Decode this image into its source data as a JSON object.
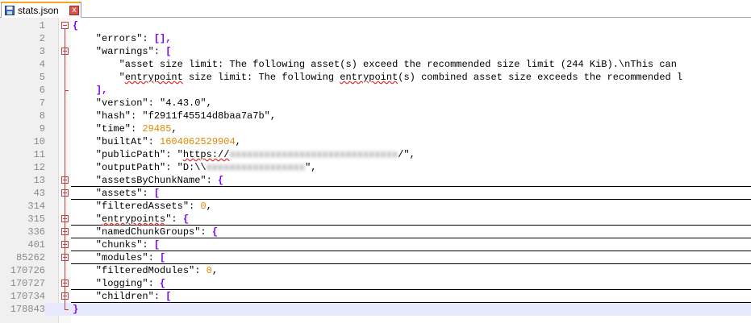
{
  "tab": {
    "filename": "stats.json",
    "close_symbol": "x"
  },
  "lines": [
    {
      "n": "1",
      "parts": [
        {
          "t": "{",
          "c": "p"
        }
      ]
    },
    {
      "n": "2",
      "parts": [
        {
          "t": "    \"errors\": ",
          "c": "s"
        },
        {
          "t": "[],",
          "c": "p"
        }
      ]
    },
    {
      "n": "3",
      "parts": [
        {
          "t": "    \"warnings\": ",
          "c": "s"
        },
        {
          "t": "[",
          "c": "p"
        }
      ]
    },
    {
      "n": "4",
      "parts": [
        {
          "t": "        \"asset size limit: The following asset(s) exceed the recommended size limit (244 KiB).\\nThis can",
          "c": "s"
        }
      ]
    },
    {
      "n": "5",
      "parts": [
        {
          "t": "        \"",
          "c": "s"
        },
        {
          "t": "entrypoint",
          "c": "s squiggle"
        },
        {
          "t": " size limit: The following ",
          "c": "s"
        },
        {
          "t": "entrypoint",
          "c": "s squiggle"
        },
        {
          "t": "(s) combined asset size exceeds the recommended l",
          "c": "s"
        }
      ]
    },
    {
      "n": "6",
      "parts": [
        {
          "t": "    ",
          "c": "s"
        },
        {
          "t": "],",
          "c": "p"
        }
      ]
    },
    {
      "n": "7",
      "parts": [
        {
          "t": "    \"version\": \"4.43.0\",",
          "c": "s"
        }
      ]
    },
    {
      "n": "8",
      "parts": [
        {
          "t": "    \"hash\": \"f2911f45514d8baa7a7b\",",
          "c": "s"
        }
      ]
    },
    {
      "n": "9",
      "parts": [
        {
          "t": "    \"time\": ",
          "c": "s"
        },
        {
          "t": "29485",
          "c": "n"
        },
        {
          "t": ",",
          "c": "s"
        }
      ]
    },
    {
      "n": "10",
      "parts": [
        {
          "t": "    \"builtAt\": ",
          "c": "s"
        },
        {
          "t": "1604062529904",
          "c": "n"
        },
        {
          "t": ",",
          "c": "s"
        }
      ]
    },
    {
      "n": "11",
      "parts": [
        {
          "t": "    \"publicPath\": \"",
          "c": "s"
        },
        {
          "t": "https://",
          "c": "s squiggle"
        },
        {
          "t": "xxxxxxxxxxxxxxxxxxxxxxxxxxxxx",
          "c": "blur"
        },
        {
          "t": "/\",",
          "c": "s"
        }
      ]
    },
    {
      "n": "12",
      "parts": [
        {
          "t": "    \"outputPath\": \"D:\\\\",
          "c": "s"
        },
        {
          "t": "xxxxxxxxxxxxxxxxx",
          "c": "blur"
        },
        {
          "t": "\",",
          "c": "s"
        }
      ]
    },
    {
      "n": "13",
      "parts": [
        {
          "t": "    \"assetsByChunkName\": ",
          "c": "s"
        },
        {
          "t": "{",
          "c": "p"
        }
      ]
    },
    {
      "n": "43",
      "parts": [
        {
          "t": "    \"assets\": ",
          "c": "s"
        },
        {
          "t": "[",
          "c": "p"
        }
      ]
    },
    {
      "n": "314",
      "parts": [
        {
          "t": "    \"filteredAssets\": ",
          "c": "s"
        },
        {
          "t": "0",
          "c": "n"
        },
        {
          "t": ",",
          "c": "s"
        }
      ]
    },
    {
      "n": "315",
      "parts": [
        {
          "t": "    \"",
          "c": "s"
        },
        {
          "t": "entrypoints",
          "c": "s squiggle"
        },
        {
          "t": "\": ",
          "c": "s"
        },
        {
          "t": "{",
          "c": "p"
        }
      ]
    },
    {
      "n": "336",
      "parts": [
        {
          "t": "    \"namedChunkGroups\": ",
          "c": "s"
        },
        {
          "t": "{",
          "c": "p"
        }
      ]
    },
    {
      "n": "401",
      "parts": [
        {
          "t": "    \"chunks\": ",
          "c": "s"
        },
        {
          "t": "[",
          "c": "p"
        }
      ]
    },
    {
      "n": "85262",
      "parts": [
        {
          "t": "    \"modules\": ",
          "c": "s"
        },
        {
          "t": "[",
          "c": "p"
        }
      ]
    },
    {
      "n": "170726",
      "parts": [
        {
          "t": "    \"filteredModules\": ",
          "c": "s"
        },
        {
          "t": "0",
          "c": "n"
        },
        {
          "t": ",",
          "c": "s"
        }
      ]
    },
    {
      "n": "170727",
      "parts": [
        {
          "t": "    \"logging\": ",
          "c": "s"
        },
        {
          "t": "{",
          "c": "p"
        }
      ]
    },
    {
      "n": "170734",
      "parts": [
        {
          "t": "    \"children\": ",
          "c": "s"
        },
        {
          "t": "[",
          "c": "p"
        }
      ]
    },
    {
      "n": "178843",
      "parts": [
        {
          "t": "}",
          "c": "p"
        }
      ]
    }
  ],
  "colors": {
    "bracket": "#8000ff",
    "number": "#e08a00",
    "fold_marker": "#c43c3c",
    "current_line": "#e8e8ff"
  },
  "icons": {
    "tab_icon": "save-disk-icon",
    "fold_open": "fold-minus-icon",
    "fold_closed": "fold-plus-icon"
  }
}
